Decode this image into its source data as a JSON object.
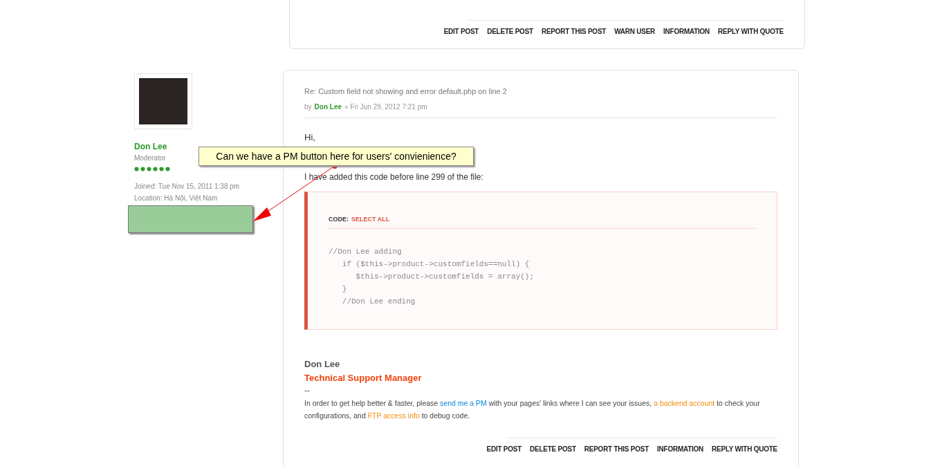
{
  "previous_post": {
    "actions": [
      "EDIT POST",
      "DELETE POST",
      "REPORT THIS POST",
      "WARN USER",
      "INFORMATION",
      "REPLY WITH QUOTE"
    ]
  },
  "author": {
    "name": "Don Lee",
    "rank": "Moderator",
    "joined": "Joined: Tue Nov 15, 2011 1:38 pm",
    "location": "Location: Hà Nội, Việt Nam"
  },
  "callout": {
    "text": "Can we have a PM button here for users' convienience?"
  },
  "post": {
    "title": "Re: Custom field not showing and error default.php on line 2",
    "by": "by",
    "author": "Don Lee",
    "date": "» Fri Jun 29, 2012 7:21 pm",
    "body": [
      "Hi,",
      "I have added this code before line 299 of the file:"
    ],
    "code": {
      "label": "CODE:",
      "select_all": "SELECT ALL",
      "lines": [
        "//Don Lee adding",
        "   if ($this->product->customfields==null) {",
        "      $this->product->customfields = array();",
        "   }",
        "   //Don Lee ending"
      ]
    },
    "signature": {
      "name": "Don Lee",
      "title": "Technical Support Manager",
      "separator": "--",
      "segments": [
        {
          "kind": "text",
          "text": "In order to get help better & faster, please "
        },
        {
          "kind": "pm-link",
          "text": "send me a PM"
        },
        {
          "kind": "text",
          "text": " with your pages' links where I can see your issues, "
        },
        {
          "kind": "link",
          "text": "a backend account"
        },
        {
          "kind": "text",
          "text": " to check your configurations, and "
        },
        {
          "kind": "link",
          "text": "FTP access info"
        },
        {
          "kind": "text",
          "text": " to debug code."
        }
      ]
    },
    "actions": [
      "EDIT POST",
      "DELETE POST",
      "REPORT THIS POST",
      "INFORMATION",
      "REPLY WITH QUOTE"
    ]
  }
}
